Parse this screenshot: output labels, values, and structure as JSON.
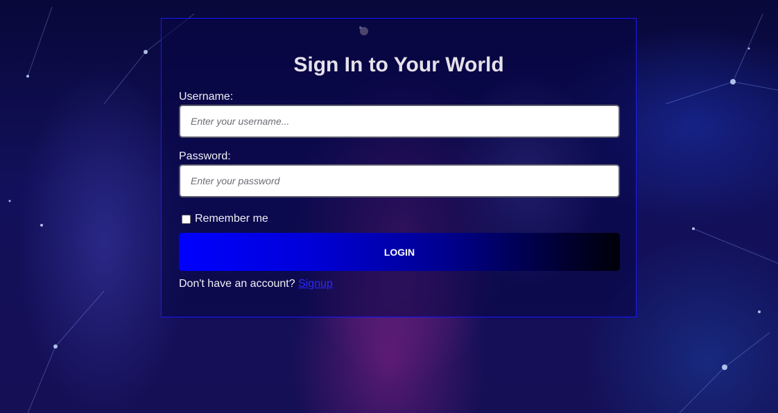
{
  "login": {
    "title": "Sign In to Your World",
    "username_label": "Username:",
    "username_placeholder": "Enter your username...",
    "password_label": "Password:",
    "password_placeholder": "Enter your password",
    "remember_label": "Remember me",
    "remember_checked": false,
    "login_button": "LOGIN",
    "signup_prompt": "Don't have an account?",
    "signup_link": "Signup"
  },
  "colors": {
    "card_border": "#1a17ff",
    "button_gradient_start": "#0000ff",
    "button_gradient_end": "#000008",
    "link": "#2a2aff",
    "title": "#e6e1ea"
  }
}
